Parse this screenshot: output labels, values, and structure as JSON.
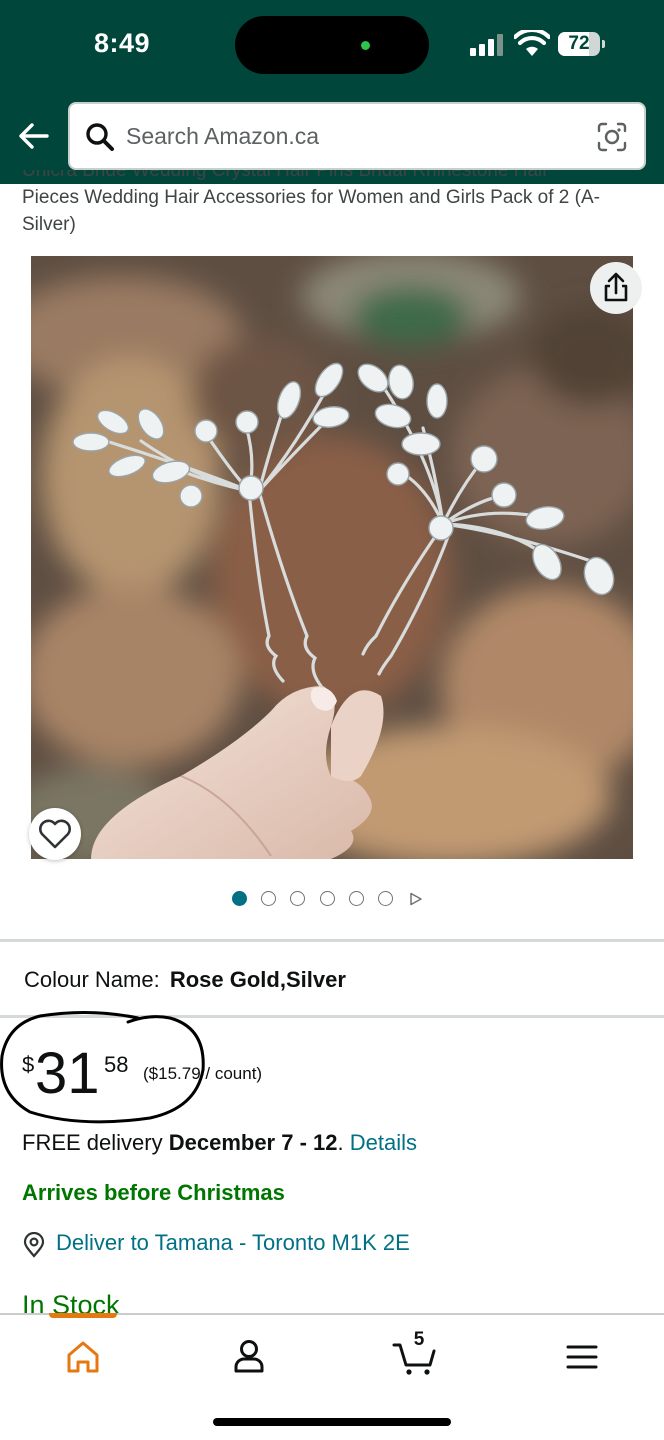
{
  "status_bar": {
    "time": "8:49",
    "battery_percent": "72"
  },
  "header": {
    "search_placeholder": "Search Amazon.ca",
    "icons": [
      "back-arrow-icon",
      "search-icon",
      "camera-lens-icon"
    ]
  },
  "product": {
    "title_cut_line": "Unicra Bride Wedding Crystal Hair Pins Bridal Rhinestone Hair",
    "title_visible": "Pieces Wedding Hair Accessories for Women and Girls Pack of 2 (A-Silver)",
    "image_count": 6,
    "image_active_index": 0,
    "colour_label": "Colour Name:",
    "colour_value": "Rose Gold,Silver",
    "price_symbol": "$",
    "price_whole": "31",
    "price_fraction": "58",
    "unit_price": "($15.79 / count)",
    "delivery_prefix": "FREE delivery ",
    "delivery_dates": "December 7 - 12",
    "delivery_period": ". ",
    "delivery_link": "Details",
    "arrival_note": "Arrives before Christmas",
    "deliver_to": "Deliver to Tamana - Toronto M1K 2E",
    "stock": "In Stock"
  },
  "nav": {
    "cart_count": "5",
    "active_item": "home",
    "items": [
      "home",
      "account",
      "cart",
      "menu"
    ]
  },
  "colors": {
    "header_bg": "#00463a",
    "link": "#007185",
    "success": "#007600",
    "accent": "#e47911"
  }
}
